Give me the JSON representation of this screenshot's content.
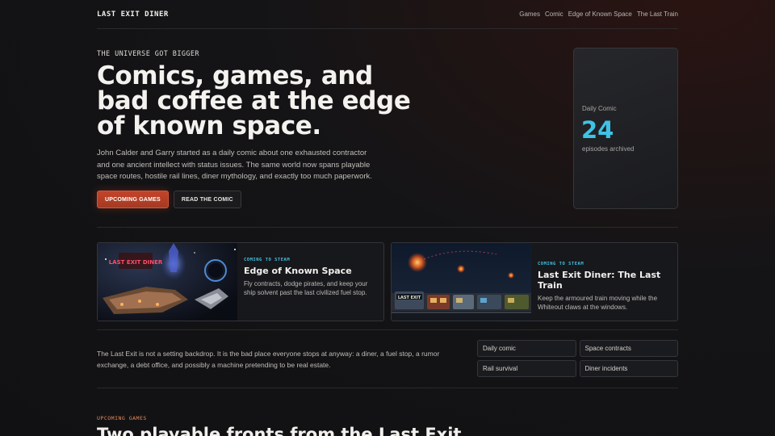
{
  "header": {
    "brand": "LAST EXIT DINER",
    "nav": [
      "Games",
      "Comic",
      "Edge of Known Space",
      "The Last Train"
    ]
  },
  "hero": {
    "eyebrow": "THE UNIVERSE GOT BIGGER",
    "headline": "Comics, games, and bad coffee at the edge of known space.",
    "lede": "John Calder and Garry started as a daily comic about one exhausted contractor and one ancient intellect with status issues. The same world now spans playable space routes, hostile rail lines, diner mythology, and exactly too much paperwork.",
    "primary_cta": "UPCOMING GAMES",
    "secondary_cta": "READ THE COMIC"
  },
  "stat_card": {
    "label": "Daily Comic",
    "value": "24",
    "sub": "episodes archived"
  },
  "games": [
    {
      "tag": "COMING TO STEAM",
      "title": "Edge of Known Space",
      "desc": "Fly contracts, dodge pirates, and keep your ship solvent past the last civilized fuel stop.",
      "thumb_sign": "LAST EXIT DINER"
    },
    {
      "tag": "COMING TO STEAM",
      "title": "Last Exit Diner: The Last Train",
      "desc": "Keep the armoured train moving while the Whiteout claws at the windows.",
      "thumb_sign": "LAST EXIT"
    }
  ],
  "about": {
    "text": "The Last Exit is not a setting backdrop. It is the bad place everyone stops at anyway: a diner, a fuel stop, a rumor exchange, a debt office, and possibly a machine pretending to be real estate.",
    "chips": [
      "Daily comic",
      "Space contracts",
      "Rail survival",
      "Diner incidents"
    ]
  },
  "upcoming": {
    "eyebrow": "UPCOMING GAMES",
    "heading": "Two playable fronts from the Last Exit"
  },
  "colors": {
    "accent": "#3ec3e6",
    "primary_button": "#b63f25",
    "eyebrow_orange": "#e58a5a",
    "background": "#141416"
  }
}
